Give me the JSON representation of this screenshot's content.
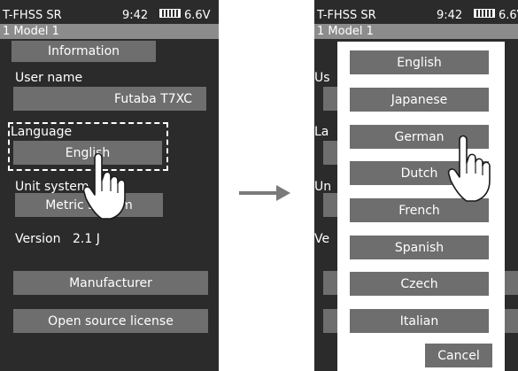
{
  "status": {
    "system": "T-FHSS SR",
    "time": "9:42",
    "voltage": "6.6V"
  },
  "model": {
    "label": "1   Model 1"
  },
  "left": {
    "information_button": "Information",
    "user_name_label": "User name",
    "user_name_value": "Futaba T7XC",
    "language_label": "Language",
    "language_value": "English",
    "unit_system_label": "Unit system",
    "unit_system_value": "Metric system",
    "version_label": "Version",
    "version_value": "2.1 J",
    "manufacturer_button": "Manufacturer",
    "license_button": "Open source license"
  },
  "right": {
    "partial_labels": [
      "Us",
      "La",
      "Un",
      "Ve"
    ],
    "languages": [
      "English",
      "Japanese",
      "German",
      "Dutch",
      "French",
      "Spanish",
      "Czech",
      "Italian"
    ],
    "cancel_button": "Cancel"
  },
  "colors": {
    "screen_bg": "#2b2b2b",
    "button": "#6e6e6e",
    "model_bar": "#8c8c8c",
    "popup": "#ffffff"
  }
}
